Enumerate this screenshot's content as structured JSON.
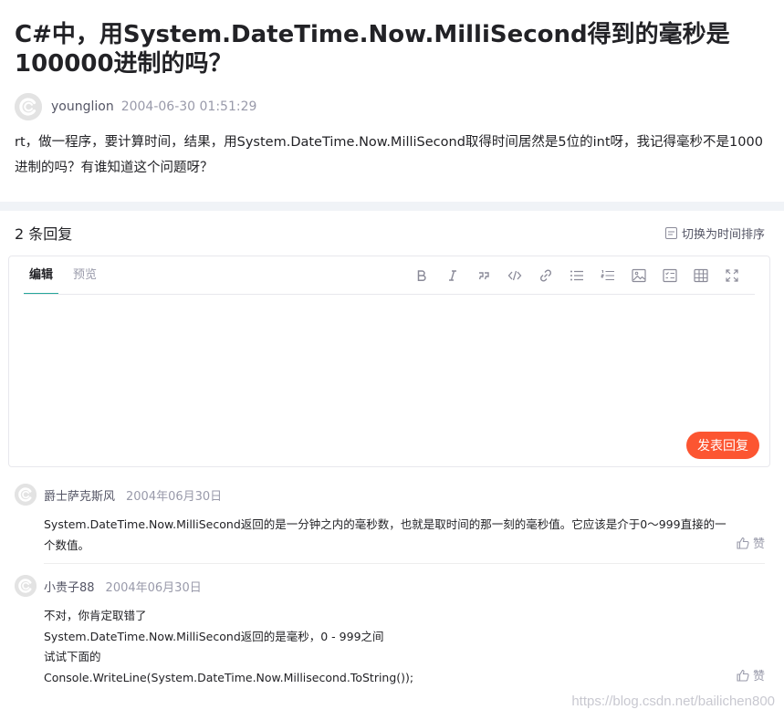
{
  "question": {
    "title": "C#中，用System.DateTime.Now.MilliSecond得到的毫秒是100000进制的吗？",
    "author": "younglion",
    "time": "2004-06-30 01:51:29",
    "body": "rt，做一程序，要计算时间，结果，用System.DateTime.Now.MilliSecond取得时间居然是5位的int呀，我记得毫秒不是1000进制的吗？有谁知道这个问题呀？"
  },
  "replies_header": {
    "count_label": "2 条回复",
    "sort_label": "切换为时间排序"
  },
  "editor": {
    "tabs": [
      "编辑",
      "预览"
    ],
    "toolbar": [
      "bold-icon",
      "italic-icon",
      "quote-icon",
      "code-icon",
      "link-icon",
      "bullet-list-icon",
      "ordered-list-icon",
      "image-icon",
      "checklist-icon",
      "table-icon",
      "fullscreen-icon"
    ],
    "submit_label": "发表回复"
  },
  "replies": [
    {
      "author": "爵士萨克斯风",
      "time": "2004年06月30日",
      "lines": [
        "System.DateTime.Now.MilliSecond返回的是一分钟之内的毫秒数，也就是取时间的那一刻的毫秒值。它应该是介于0～999直接的一个数值。"
      ],
      "like_label": "赞"
    },
    {
      "author": "小贵子88",
      "time": "2004年06月30日",
      "lines": [
        "不对，你肯定取错了",
        "System.DateTime.Now.MilliSecond返回的是毫秒，0 - 999之间",
        "试试下面的",
        "Console.WriteLine(System.DateTime.Now.Millisecond.ToString());"
      ],
      "like_label": "赞"
    }
  ],
  "watermark": "https://blog.csdn.net/bailichen800",
  "colors": {
    "accent": "#fc5531",
    "tab_underline": "#26a69a",
    "separator": "#f0f3f7"
  }
}
